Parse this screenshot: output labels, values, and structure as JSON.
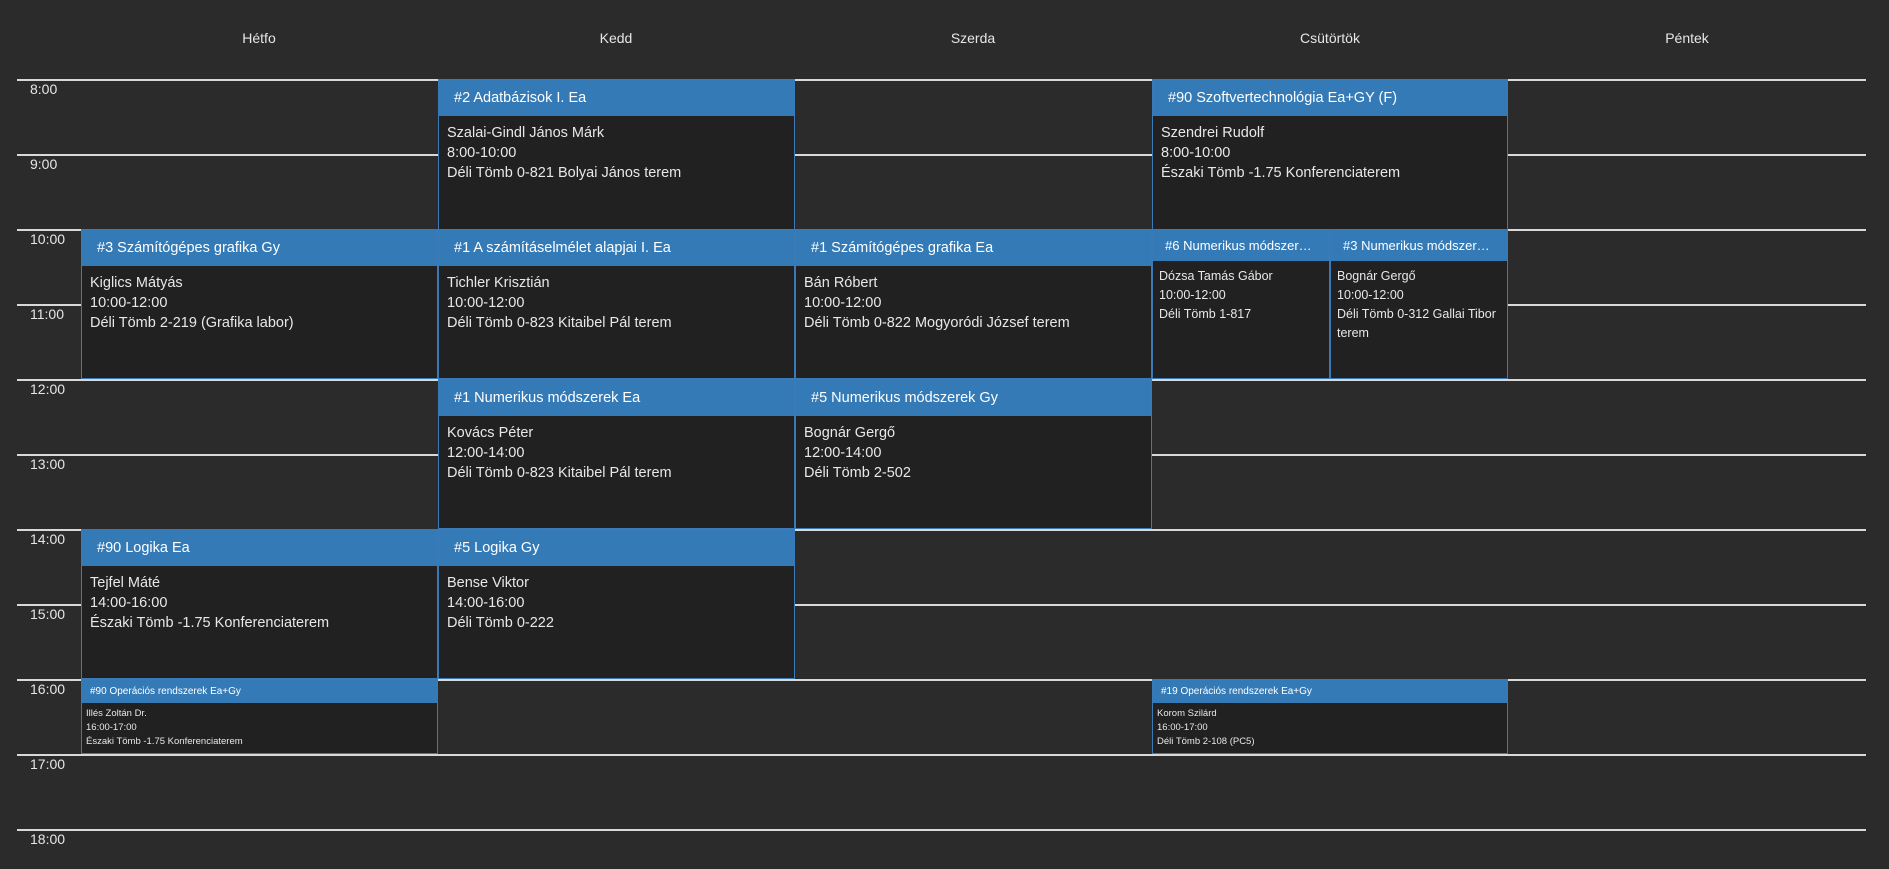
{
  "days": [
    "Hétfo",
    "Kedd",
    "Szerda",
    "Csütörtök",
    "Péntek"
  ],
  "hours": [
    "8:00",
    "9:00",
    "10:00",
    "11:00",
    "12:00",
    "13:00",
    "14:00",
    "15:00",
    "16:00",
    "17:00",
    "18:00"
  ],
  "colors": {
    "background": "#2b2b2b",
    "event_header": "#337ab7",
    "event_body": "#212121",
    "grid_line": "#d9d9d9"
  },
  "events": [
    {
      "title": "#2 Adatbázisok I. Ea",
      "teacher": "Szalai-Gindl János Márk",
      "time": "8:00-10:00",
      "room": "Déli Tömb 0-821 Bolyai János terem"
    },
    {
      "title": "#90 Szoftvertechnológia Ea+GY (F)",
      "teacher": "Szendrei Rudolf",
      "time": "8:00-10:00",
      "room": "Északi Tömb -1.75 Konferenciaterem"
    },
    {
      "title": "#3 Számítógépes grafika Gy",
      "teacher": "Kiglics Mátyás",
      "time": "10:00-12:00",
      "room": "Déli Tömb 2-219 (Grafika labor)"
    },
    {
      "title": "#1 A számításelmélet alapjai I. Ea",
      "teacher": "Tichler Krisztián",
      "time": "10:00-12:00",
      "room": "Déli Tömb 0-823 Kitaibel Pál terem"
    },
    {
      "title": "#1 Számítógépes grafika Ea",
      "teacher": "Bán Róbert",
      "time": "10:00-12:00",
      "room": "Déli Tömb 0-822 Mogyoródi József terem"
    },
    {
      "title": "#6 Numerikus módszer…",
      "teacher": "Dózsa Tamás Gábor",
      "time": "10:00-12:00",
      "room": "Déli Tömb 1-817"
    },
    {
      "title": "#3 Numerikus módszer…",
      "teacher": "Bognár Gergő",
      "time": "10:00-12:00",
      "room": "Déli Tömb 0-312 Gallai Tibor terem"
    },
    {
      "title": "#1 Numerikus módszerek Ea",
      "teacher": "Kovács Péter",
      "time": "12:00-14:00",
      "room": "Déli Tömb 0-823 Kitaibel Pál terem"
    },
    {
      "title": "#5 Numerikus módszerek Gy",
      "teacher": "Bognár Gergő",
      "time": "12:00-14:00",
      "room": "Déli Tömb 2-502"
    },
    {
      "title": "#90 Logika Ea",
      "teacher": "Tejfel Máté",
      "time": "14:00-16:00",
      "room": "Északi Tömb -1.75 Konferenciaterem"
    },
    {
      "title": "#5 Logika Gy",
      "teacher": "Bense Viktor",
      "time": "14:00-16:00",
      "room": "Déli Tömb 0-222"
    },
    {
      "title": "#90 Operációs rendszerek Ea+Gy",
      "teacher": "Illés Zoltán Dr.",
      "time": "16:00-17:00",
      "room": "Északi Tömb -1.75 Konferenciaterem"
    },
    {
      "title": "#19 Operációs rendszerek Ea+Gy",
      "teacher": "Korom Szilárd",
      "time": "16:00-17:00",
      "room": "Déli Tömb 2-108 (PC5)"
    }
  ]
}
